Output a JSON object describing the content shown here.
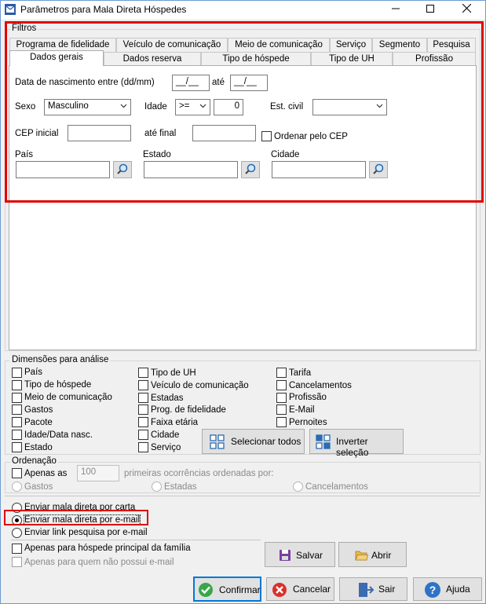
{
  "window": {
    "title": "Parâmetros para Mala Direta Hóspedes",
    "minimize": "—",
    "maximize": "☐",
    "close": "✕"
  },
  "filters": {
    "group_label": "Filtros",
    "tabs_row1": [
      "Programa de fidelidade",
      "Veículo de comunicação",
      "Meio de comunicação",
      "Serviço",
      "Segmento",
      "Pesquisa"
    ],
    "tabs_row2": [
      "Dados gerais",
      "Dados reserva",
      "Tipo de hóspede",
      "Tipo de UH",
      "Profissão"
    ],
    "birth_label": "Data de nascimento entre (dd/mm)",
    "birth_from": "__/__",
    "birth_to_label": "até",
    "birth_to": "__/__",
    "sex_label": "Sexo",
    "sex_value": "Masculino",
    "age_label": "Idade",
    "age_op": ">=",
    "age_value": "0",
    "civil_label": "Est. civil",
    "civil_value": "",
    "cep_label": "CEP inicial",
    "cep_to_label": "até final",
    "cep_order_label": "Ordenar pelo CEP",
    "country_label": "País",
    "state_label": "Estado",
    "city_label": "Cidade"
  },
  "dimensions": {
    "group_label": "Dimensões para análise",
    "col1": [
      "País",
      "Tipo de hóspede",
      "Meio de comunicação",
      "Gastos",
      "Pacote",
      "Idade/Data nasc.",
      "Estado"
    ],
    "col2": [
      "Tipo de UH",
      "Veículo de comunicação",
      "Estadas",
      "Prog. de fidelidade",
      "Faixa etária",
      "Cidade",
      "Serviço"
    ],
    "col3": [
      "Tarifa",
      "Cancelamentos",
      "Profissão",
      "E-Mail",
      "Pernoites"
    ],
    "select_all": "Selecionar todos",
    "invert": "Inverter seleção"
  },
  "ordering": {
    "group_label": "Ordenação",
    "only_label": "Apenas as",
    "count": "100",
    "first_label": "primeiras ocorrências ordenadas por:",
    "options": [
      "Gastos",
      "Estadas",
      "Cancelamentos"
    ]
  },
  "send": {
    "letter": "Enviar mala direta por carta",
    "email": "Enviar mala direta por e-mail",
    "survey": "Enviar link pesquisa por e-mail",
    "family_main": "Apenas para hóspede principal da família",
    "no_email": "Apenas para quem não possui e-mail",
    "save": "Salvar",
    "open": "Abrir"
  },
  "footer": {
    "confirm": "Confirmar",
    "cancel": "Cancelar",
    "exit": "Sair",
    "help": "Ajuda"
  },
  "colors": {
    "highlight": "#e00000",
    "accent": "#0078d7"
  }
}
